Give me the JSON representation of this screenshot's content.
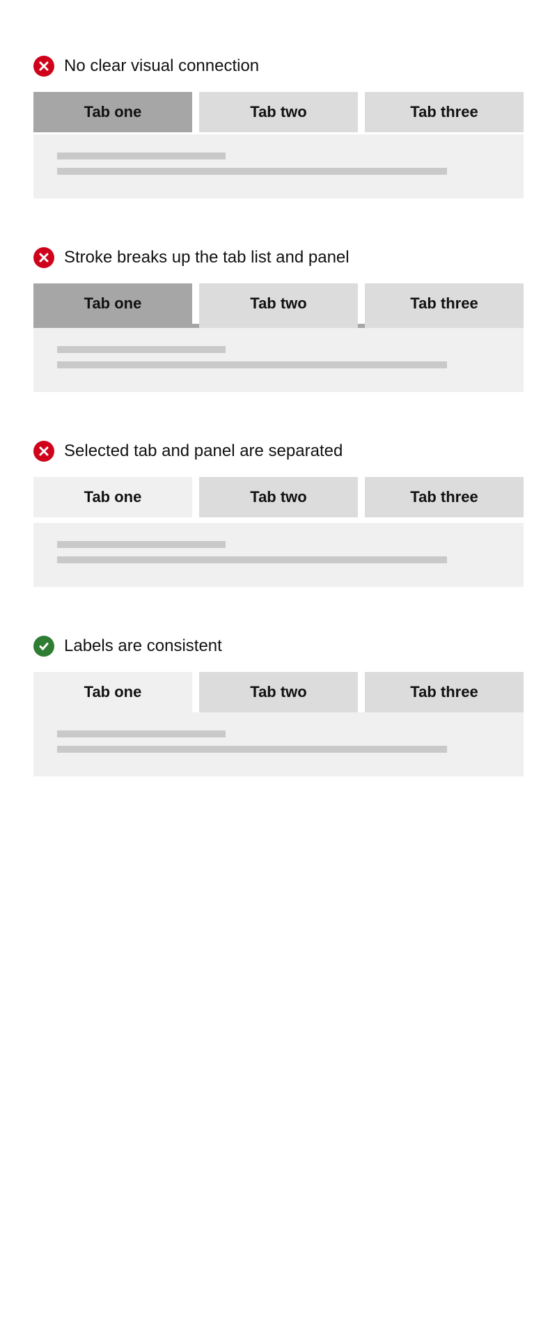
{
  "examples": [
    {
      "status": "error",
      "caption": "No clear visual connection",
      "tabs": [
        "Tab one",
        "Tab two",
        "Tab three"
      ]
    },
    {
      "status": "error",
      "caption": "Stroke breaks up the tab list and panel",
      "tabs": [
        "Tab one",
        "Tab two",
        "Tab three"
      ]
    },
    {
      "status": "error",
      "caption": "Selected tab and panel are separated",
      "tabs": [
        "Tab one",
        "Tab two",
        "Tab three"
      ]
    },
    {
      "status": "success",
      "caption": "Labels are consistent",
      "tabs": [
        "Tab one",
        "Tab two",
        "Tab three"
      ]
    }
  ],
  "colors": {
    "error": "#d0021b",
    "success": "#2e7d32",
    "tab_unselected": "#dcdcdc",
    "tab_selected_dark": "#a6a6a6",
    "panel_bg": "#f0f0f0",
    "placeholder": "#c9c9c9"
  }
}
